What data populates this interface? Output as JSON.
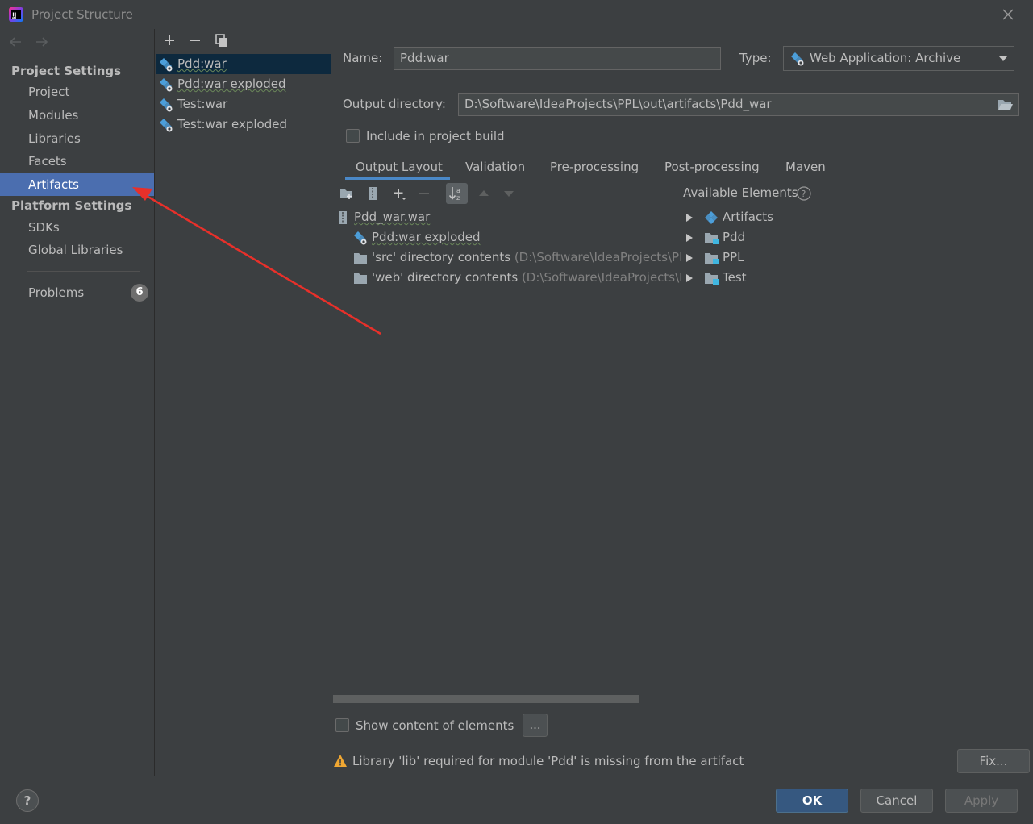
{
  "window": {
    "title": "Project Structure"
  },
  "nav": {
    "project_settings_header": "Project Settings",
    "project_settings_items": [
      "Project",
      "Modules",
      "Libraries",
      "Facets",
      "Artifacts"
    ],
    "platform_settings_header": "Platform Settings",
    "platform_settings_items": [
      "SDKs",
      "Global Libraries"
    ],
    "problems_label": "Problems",
    "problems_count": "6"
  },
  "artifacts": [
    "Pdd:war",
    "Pdd:war exploded",
    "Test:war",
    "Test:war exploded"
  ],
  "form": {
    "name_label": "Name:",
    "name_value": "Pdd:war",
    "type_label": "Type:",
    "type_value": "Web Application: Archive",
    "output_dir_label": "Output directory:",
    "output_dir_value": "D:\\Software\\IdeaProjects\\PPL\\out\\artifacts\\Pdd_war",
    "include_in_build_label": "Include in project build",
    "include_in_build_checked": false
  },
  "tabs": [
    "Output Layout",
    "Validation",
    "Pre-processing",
    "Post-processing",
    "Maven"
  ],
  "output_layout": {
    "root": "Pdd_war.war",
    "children": [
      {
        "label": "Pdd:war exploded",
        "detail": ""
      },
      {
        "label": "'src' directory contents",
        "detail": "(D:\\Software\\IdeaProjects\\PPL"
      },
      {
        "label": "'web' directory contents",
        "detail": "(D:\\Software\\IdeaProjects\\PP"
      }
    ]
  },
  "available_elements": {
    "title": "Available Elements",
    "items": [
      "Artifacts",
      "Pdd",
      "PPL",
      "Test"
    ]
  },
  "show_content_label": "Show content of elements",
  "ellipsis_button": "...",
  "warning_text": "Library 'lib' required for module 'Pdd' is missing from the artifact",
  "fix_button": "Fix...",
  "buttons": {
    "ok": "OK",
    "cancel": "Cancel",
    "apply": "Apply",
    "help": "?"
  },
  "colors": {
    "selection": "#4b6eaf",
    "accent_underline": "#4a88c7",
    "artifact_icon": "#4c9ed9",
    "annotation_arrow": "#e8302a"
  }
}
